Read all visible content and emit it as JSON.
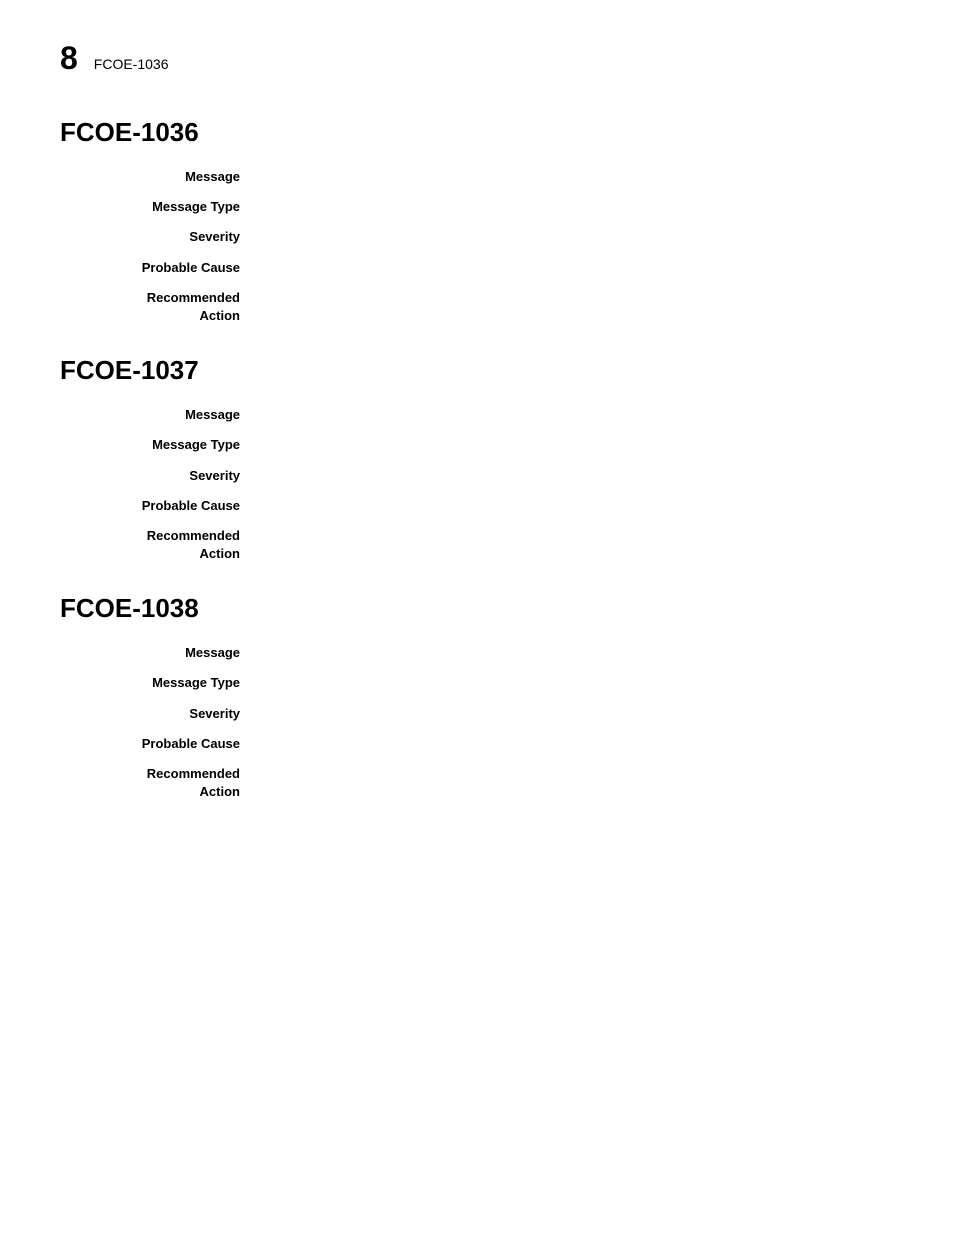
{
  "header": {
    "page_number": "8",
    "title": "FCOE-1036"
  },
  "sections": [
    {
      "id": "fcoe-1036",
      "title": "FCOE-1036",
      "fields": [
        {
          "label": "Message",
          "value": ""
        },
        {
          "label": "Message Type",
          "value": ""
        },
        {
          "label": "Severity",
          "value": ""
        },
        {
          "label": "Probable Cause",
          "value": ""
        },
        {
          "label": "Recommended Action",
          "value": ""
        }
      ]
    },
    {
      "id": "fcoe-1037",
      "title": "FCOE-1037",
      "fields": [
        {
          "label": "Message",
          "value": ""
        },
        {
          "label": "Message Type",
          "value": ""
        },
        {
          "label": "Severity",
          "value": ""
        },
        {
          "label": "Probable Cause",
          "value": ""
        },
        {
          "label": "Recommended Action",
          "value": ""
        }
      ]
    },
    {
      "id": "fcoe-1038",
      "title": "FCOE-1038",
      "fields": [
        {
          "label": "Message",
          "value": ""
        },
        {
          "label": "Message Type",
          "value": ""
        },
        {
          "label": "Severity",
          "value": ""
        },
        {
          "label": "Probable Cause",
          "value": ""
        },
        {
          "label": "Recommended Action",
          "value": ""
        }
      ]
    }
  ]
}
